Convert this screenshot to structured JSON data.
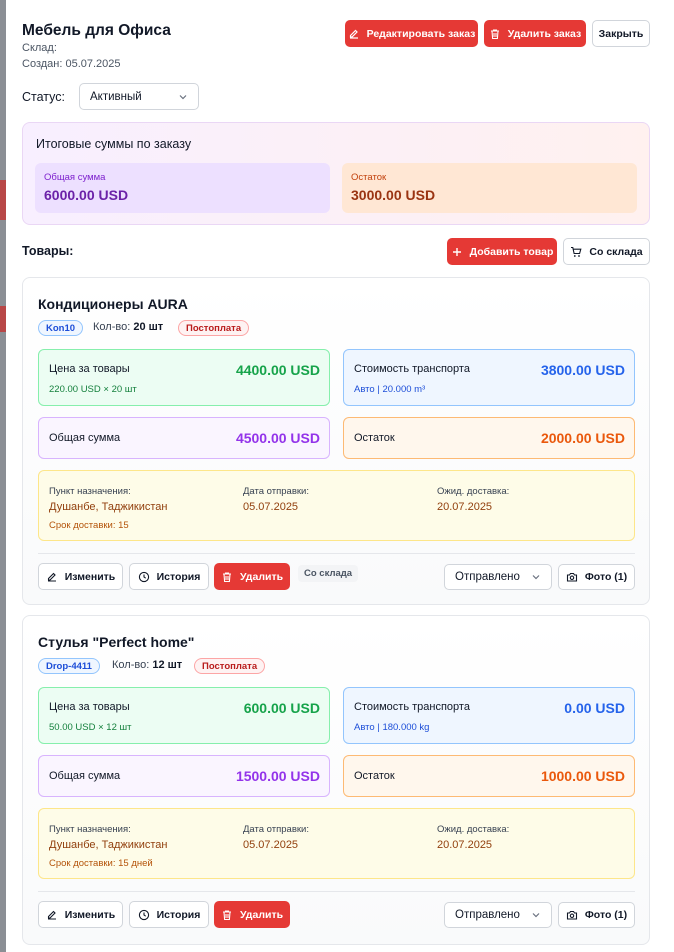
{
  "header": {
    "title": "Мебель для Офиса",
    "warehouse": "Склад:",
    "created": "Создан: 05.07.2025",
    "edit_label": "Редактировать заказ",
    "delete_label": "Удалить заказ",
    "close_label": "Закрыть"
  },
  "status": {
    "label": "Статус:",
    "value": "Активный"
  },
  "totals": {
    "title": "Итоговые суммы по заказу",
    "total_label": "Общая сумма",
    "total_value": "6000.00 USD",
    "balance_label": "Остаток",
    "balance_value": "3000.00 USD"
  },
  "products_header": {
    "label": "Товары:",
    "add_label": "Добавить товар",
    "from_stock_label": "Со склада"
  },
  "products": [
    {
      "name": "Кондиционеры AURA",
      "code": "Kon10",
      "qty_label": "Кол-во:",
      "qty_value": "20 шт",
      "payment": "Постоплата",
      "price_label": "Цена за товары",
      "price_value": "4400.00 USD",
      "price_sub": "220.00 USD × 20 шт",
      "transport_label": "Стоимость транспорта",
      "transport_value": "3800.00 USD",
      "transport_sub": "Авто | 20.000 m³",
      "total_label": "Общая сумма",
      "total_value": "4500.00 USD",
      "balance_label": "Остаток",
      "balance_value": "2000.00 USD",
      "dest_label": "Пункт назначения:",
      "dest_value": "Душанбе, Таджикистан",
      "ship_label": "Дата отправки:",
      "ship_value": "05.07.2025",
      "eta_label": "Ожид. доставка:",
      "eta_value": "20.07.2025",
      "term": "Срок доставки: 15",
      "edit_label": "Изменить",
      "history_label": "История",
      "delete_label": "Удалить",
      "warehouse_badge": "Со склада",
      "status_value": "Отправлено",
      "photo_label": "Фото (1)"
    },
    {
      "name": "Стулья \"Perfect home\"",
      "code": "Drop-4411",
      "qty_label": "Кол-во:",
      "qty_value": "12 шт",
      "payment": "Постоплата",
      "price_label": "Цена за товары",
      "price_value": "600.00 USD",
      "price_sub": "50.00 USD × 12 шт",
      "transport_label": "Стоимость транспорта",
      "transport_value": "0.00 USD",
      "transport_sub": "Авто | 180.000 kg",
      "total_label": "Общая сумма",
      "total_value": "1500.00 USD",
      "balance_label": "Остаток",
      "balance_value": "1000.00 USD",
      "dest_label": "Пункт назначения:",
      "dest_value": "Душанбе, Таджикистан",
      "ship_label": "Дата отправки:",
      "ship_value": "05.07.2025",
      "eta_label": "Ожид. доставка:",
      "eta_value": "20.07.2025",
      "term": "Срок доставки: 15 дней",
      "edit_label": "Изменить",
      "history_label": "История",
      "delete_label": "Удалить",
      "status_value": "Отправлено",
      "photo_label": "Фото (1)"
    }
  ],
  "colors": {
    "accent_red": "#e53935",
    "green": "#16a34a",
    "blue": "#2563eb",
    "purple": "#9333ea",
    "orange": "#ea580c"
  }
}
